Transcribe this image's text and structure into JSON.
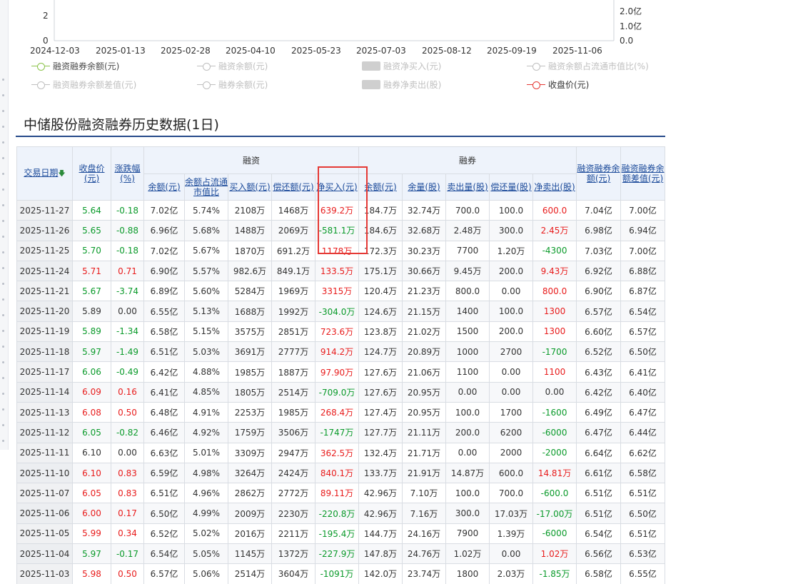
{
  "chart": {
    "y_ticks": [
      "2",
      "0"
    ],
    "y2_ticks": [
      "2.0亿",
      "1.0亿",
      "0.0"
    ],
    "x_ticks": [
      "2024-12-03",
      "2025-01-13",
      "2025-02-28",
      "2025-04-10",
      "2025-05-23",
      "2025-07-03",
      "2025-08-12",
      "2025-09-19",
      "2025-11-06"
    ],
    "legend": [
      {
        "label": "融资融券余额(元)",
        "state": "active",
        "marker": "line"
      },
      {
        "label": "融资余额(元)",
        "state": "off",
        "marker": "line"
      },
      {
        "label": "融资净买入(元)",
        "state": "off",
        "marker": "bar"
      },
      {
        "label": "融资余额占流通市值比(%)",
        "state": "off",
        "marker": "line"
      },
      {
        "label": "融资融券余额差值(元)",
        "state": "off",
        "marker": "line"
      },
      {
        "label": "融券余额(元)",
        "state": "off",
        "marker": "line"
      },
      {
        "label": "融券净卖出(股)",
        "state": "off",
        "marker": "bar"
      },
      {
        "label": "收盘价(元)",
        "state": "red",
        "marker": "line"
      }
    ]
  },
  "section_title": "中储股份融资融券历史数据(1日)",
  "table": {
    "headers": {
      "date": "交易日期",
      "close": "收盘价(元)",
      "change": "涨跌幅(%)",
      "margin_group": "融资",
      "short_group": "融券",
      "margin_balance": "余额(元)",
      "margin_ratio": "余额占流通市值比",
      "margin_buy": "买入额(元)",
      "margin_repay": "偿还额(元)",
      "margin_net": "净买入(元)",
      "short_balance": "余额(元)",
      "short_volume": "余量(股)",
      "short_sell": "卖出量(股)",
      "short_repay": "偿还量(股)",
      "short_net": "净卖出(股)",
      "total_balance": "融资融券余额(元)",
      "diff_balance": "融资融券余额差值(元)"
    },
    "colors": {
      "up": "#e81c1c",
      "down": "#0a9a2a",
      "header_bg": "#eef3fb",
      "highlight": "#e53935"
    },
    "rows": [
      [
        "2025-11-27",
        "5.64",
        "-0.18",
        "7.02亿",
        "5.74%",
        "2108万",
        "1468万",
        "639.2万",
        "184.7万",
        "32.74万",
        "700.0",
        "100.0",
        "600.0",
        "7.04亿",
        "7.00亿"
      ],
      [
        "2025-11-26",
        "5.65",
        "-0.88",
        "6.96亿",
        "5.68%",
        "1488万",
        "2069万",
        "-581.1万",
        "184.6万",
        "32.68万",
        "2.48万",
        "300.0",
        "2.45万",
        "6.98亿",
        "6.94亿"
      ],
      [
        "2025-11-25",
        "5.70",
        "-0.18",
        "7.02亿",
        "5.67%",
        "1870万",
        "691.2万",
        "1178万",
        "172.3万",
        "30.23万",
        "7700",
        "1.20万",
        "-4300",
        "7.03亿",
        "7.00亿"
      ],
      [
        "2025-11-24",
        "5.71",
        "0.71",
        "6.90亿",
        "5.57%",
        "982.6万",
        "849.1万",
        "133.5万",
        "175.1万",
        "30.66万",
        "9.45万",
        "200.0",
        "9.43万",
        "6.92亿",
        "6.88亿"
      ],
      [
        "2025-11-21",
        "5.67",
        "-3.74",
        "6.89亿",
        "5.60%",
        "5284万",
        "1969万",
        "3315万",
        "120.4万",
        "21.23万",
        "800.0",
        "0.00",
        "800.0",
        "6.90亿",
        "6.87亿"
      ],
      [
        "2025-11-20",
        "5.89",
        "0.00",
        "6.55亿",
        "5.13%",
        "1688万",
        "1992万",
        "-304.0万",
        "124.6万",
        "21.15万",
        "1400",
        "100.0",
        "1300",
        "6.57亿",
        "6.54亿"
      ],
      [
        "2025-11-19",
        "5.89",
        "-1.34",
        "6.58亿",
        "5.15%",
        "3575万",
        "2851万",
        "723.6万",
        "123.8万",
        "21.02万",
        "1500",
        "200.0",
        "1300",
        "6.60亿",
        "6.57亿"
      ],
      [
        "2025-11-18",
        "5.97",
        "-1.49",
        "6.51亿",
        "5.03%",
        "3691万",
        "2777万",
        "914.2万",
        "124.7万",
        "20.89万",
        "1000",
        "2700",
        "-1700",
        "6.52亿",
        "6.50亿"
      ],
      [
        "2025-11-17",
        "6.06",
        "-0.49",
        "6.42亿",
        "4.88%",
        "1985万",
        "1887万",
        "97.90万",
        "127.6万",
        "21.06万",
        "1100",
        "0.00",
        "1100",
        "6.43亿",
        "6.41亿"
      ],
      [
        "2025-11-14",
        "6.09",
        "0.16",
        "6.41亿",
        "4.85%",
        "1805万",
        "2514万",
        "-709.0万",
        "127.6万",
        "20.95万",
        "0.00",
        "0.00",
        "0.00",
        "6.42亿",
        "6.40亿"
      ],
      [
        "2025-11-13",
        "6.08",
        "0.50",
        "6.48亿",
        "4.91%",
        "2253万",
        "1985万",
        "268.4万",
        "127.4万",
        "20.95万",
        "100.0",
        "1700",
        "-1600",
        "6.49亿",
        "6.47亿"
      ],
      [
        "2025-11-12",
        "6.05",
        "-0.82",
        "6.46亿",
        "4.92%",
        "1759万",
        "3506万",
        "-1747万",
        "127.7万",
        "21.11万",
        "200.0",
        "6200",
        "-6000",
        "6.47亿",
        "6.44亿"
      ],
      [
        "2025-11-11",
        "6.10",
        "0.00",
        "6.63亿",
        "5.01%",
        "3309万",
        "2947万",
        "362.5万",
        "132.4万",
        "21.71万",
        "0.00",
        "2000",
        "-2000",
        "6.64亿",
        "6.62亿"
      ],
      [
        "2025-11-10",
        "6.10",
        "0.83",
        "6.59亿",
        "4.98%",
        "3264万",
        "2424万",
        "840.1万",
        "133.7万",
        "21.91万",
        "14.87万",
        "600.0",
        "14.81万",
        "6.61亿",
        "6.58亿"
      ],
      [
        "2025-11-07",
        "6.05",
        "0.83",
        "6.51亿",
        "4.96%",
        "2862万",
        "2772万",
        "89.11万",
        "42.96万",
        "7.10万",
        "100.0",
        "700.0",
        "-600.0",
        "6.51亿",
        "6.51亿"
      ],
      [
        "2025-11-06",
        "6.00",
        "0.17",
        "6.50亿",
        "4.99%",
        "2009万",
        "2230万",
        "-220.8万",
        "42.96万",
        "7.16万",
        "300.0",
        "17.03万",
        "-17.00万",
        "6.51亿",
        "6.50亿"
      ],
      [
        "2025-11-05",
        "5.99",
        "0.34",
        "6.52亿",
        "5.02%",
        "2016万",
        "2211万",
        "-195.4万",
        "144.7万",
        "24.16万",
        "7900",
        "1.39万",
        "-6000",
        "6.54亿",
        "6.51亿"
      ],
      [
        "2025-11-04",
        "5.97",
        "-0.17",
        "6.54亿",
        "5.05%",
        "1145万",
        "1372万",
        "-227.9万",
        "147.8万",
        "24.76万",
        "1.02万",
        "0.00",
        "1.02万",
        "6.56亿",
        "6.53亿"
      ],
      [
        "2025-11-03",
        "5.98",
        "0.50",
        "6.57亿",
        "5.06%",
        "2514万",
        "3604万",
        "-1091万",
        "142.0万",
        "23.74万",
        "1800",
        "2.03万",
        "-1.85万",
        "6.58亿",
        "6.55亿"
      ]
    ]
  }
}
